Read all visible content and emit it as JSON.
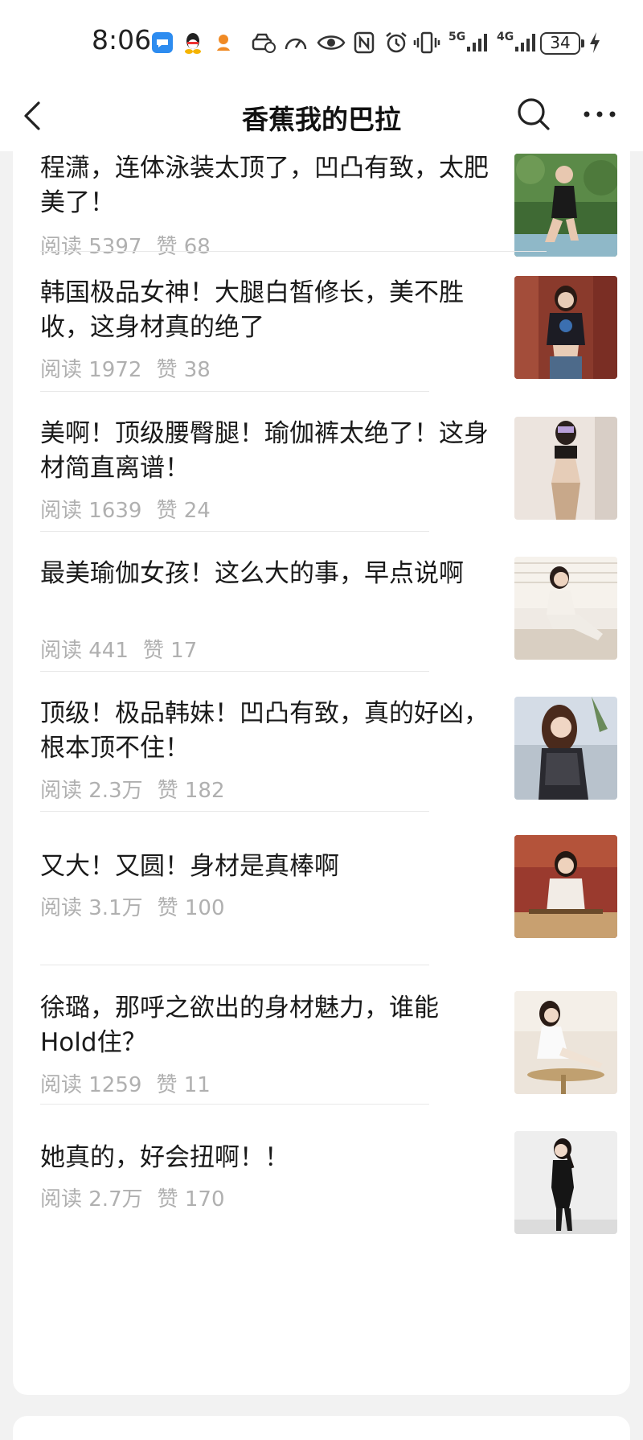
{
  "status_bar": {
    "time": "8:06",
    "signal_5g": "5G",
    "signal_4g": "4G",
    "battery": "34"
  },
  "nav": {
    "title": "香蕉我的巴拉"
  },
  "articles": [
    {
      "title": "程潇，连体泳装太顶了，凹凸有致，太肥美了！",
      "reads": "阅读 5397",
      "likes": "赞 68"
    },
    {
      "title": "韩国极品女神！大腿白皙修长，美不胜收，这身材真的绝了",
      "reads": "阅读 1972",
      "likes": "赞 38"
    },
    {
      "title": "美啊！顶级腰臀腿！瑜伽裤太绝了！这身材简直离谱！",
      "reads": "阅读 1639",
      "likes": "赞 24"
    },
    {
      "title": "最美瑜伽女孩！这么大的事，早点说啊",
      "reads": "阅读 441",
      "likes": "赞 17"
    },
    {
      "title": "顶级！极品韩妹！凹凸有致，真的好凶，根本顶不住！",
      "reads": "阅读 2.3万",
      "likes": "赞 182"
    },
    {
      "title": "又大！又圆！身材是真棒啊",
      "reads": "阅读 3.1万",
      "likes": "赞 100"
    },
    {
      "title": "徐璐，那呼之欲出的身材魅力，谁能Hold住？",
      "reads": "阅读 1259",
      "likes": "赞 11"
    },
    {
      "title": "她真的，好会扭啊！！",
      "reads": "阅读 2.7万",
      "likes": "赞 170"
    }
  ]
}
